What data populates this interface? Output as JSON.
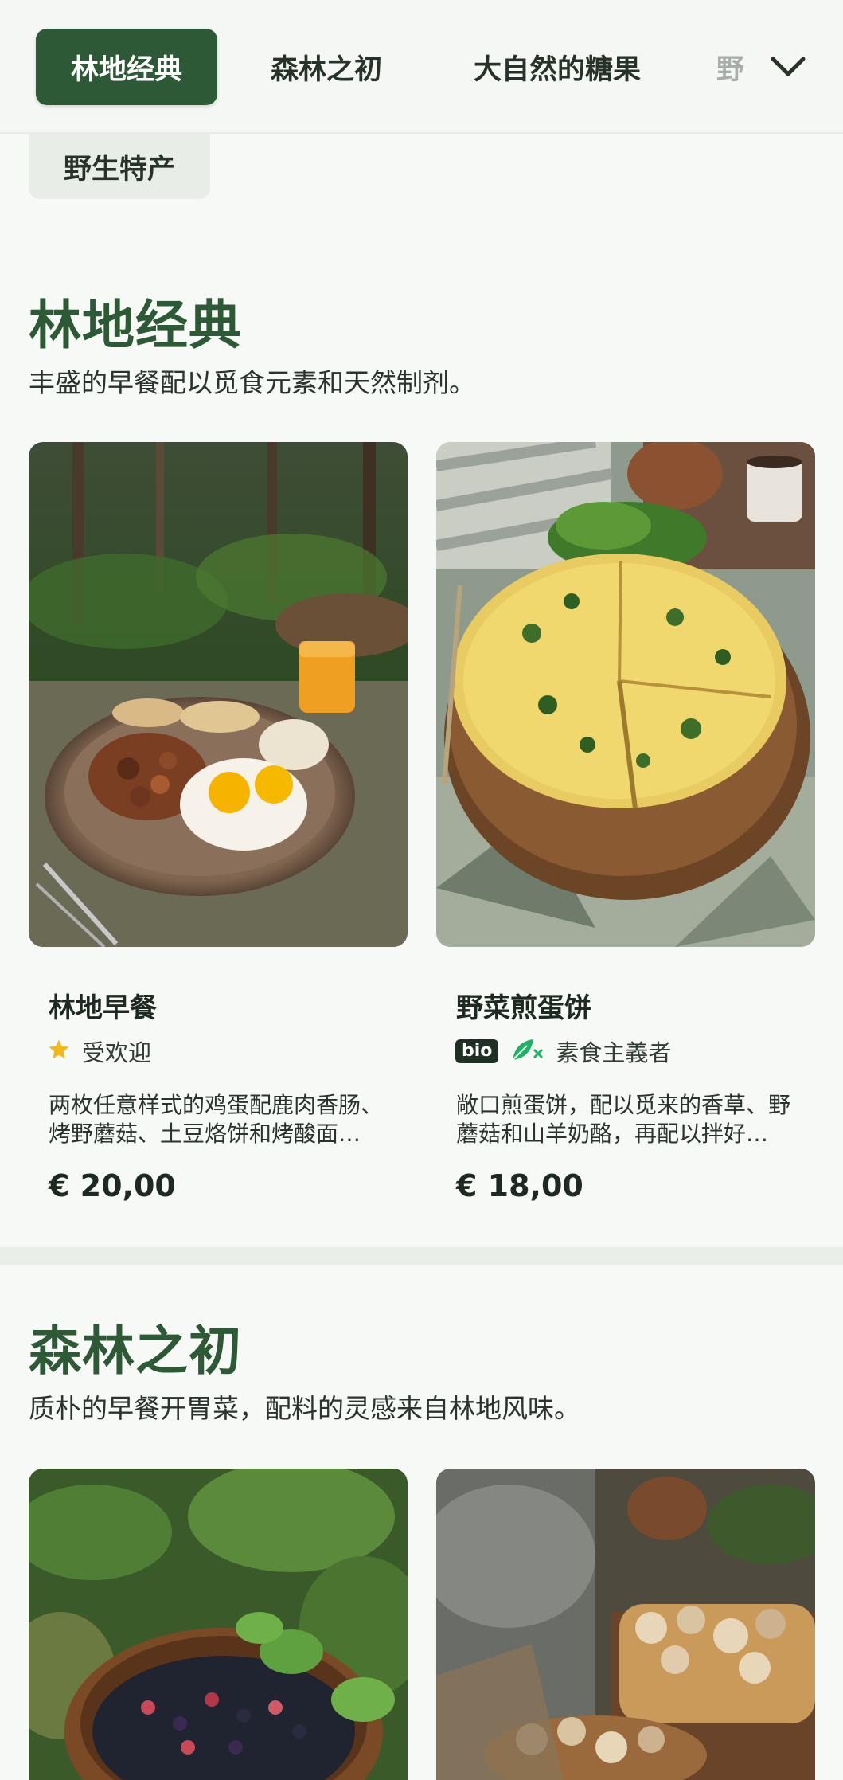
{
  "nav": {
    "tabs": [
      {
        "label": "林地经典",
        "active": true
      },
      {
        "label": "森林之初",
        "active": false
      },
      {
        "label": "大自然的糖果",
        "active": false
      },
      {
        "label": "野",
        "active": false
      }
    ],
    "overflow_tab": {
      "label": "野生特产"
    },
    "expand_icon": "chevron-down-icon"
  },
  "sections": [
    {
      "title": "林地经典",
      "description": "丰盛的早餐配以觅食元素和天然制剂。",
      "items": [
        {
          "name": "林地早餐",
          "tags": [
            {
              "icon": "star-icon",
              "label": "受欢迎"
            }
          ],
          "description": "两枚任意样式的鸡蛋配鹿肉香肠、烤野蘑菇、土豆烙饼和烤酸面包，搭配森林浆果果酱。",
          "price": "€ 20,00"
        },
        {
          "name": "野菜煎蛋饼",
          "tags": [
            {
              "icon": "bio-badge",
              "label": "bio"
            },
            {
              "icon": "vegetarian-icon",
              "label": "素食主義者"
            }
          ],
          "description": "敞口煎蛋饼，配以觅来的香草、野蘑菇和山羊奶酪，再配以拌好的森林蔬菜沙拉。",
          "price": "€ 18,00"
        }
      ]
    },
    {
      "title": "森林之初",
      "description": "质朴的早餐开胃菜，配料的灵感来自林地风味。",
      "items": [
        {
          "name": "",
          "description": "",
          "price": ""
        },
        {
          "name": "",
          "description": "",
          "price": ""
        }
      ]
    }
  ],
  "colors": {
    "brand": "#2d5936",
    "star": "#f2b71a",
    "vegetarian": "#1db264",
    "background": "#f6f9f5"
  }
}
